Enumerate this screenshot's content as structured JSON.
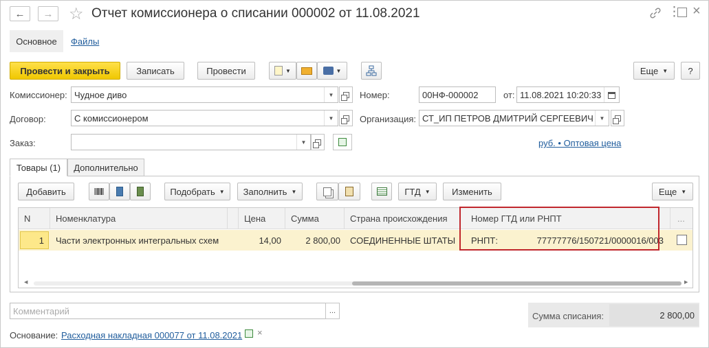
{
  "window": {
    "title": "Отчет комиссионера о списании 000002 от 11.08.2021"
  },
  "nav_tabs": {
    "main": "Основное",
    "files": "Файлы"
  },
  "toolbar": {
    "post_close": "Провести и закрыть",
    "save": "Записать",
    "post": "Провести",
    "more": "Еще",
    "help": "?"
  },
  "header": {
    "agent_label": "Комиссионер:",
    "agent_value": "Чудное диво",
    "number_label": "Номер:",
    "number_value": "00НФ-000002",
    "date_label": "от:",
    "date_value": "11.08.2021 10:20:33",
    "contract_label": "Договор:",
    "contract_value": "С комиссионером",
    "org_label": "Организация:",
    "org_value": "СТ_ИП ПЕТРОВ ДМИТРИЙ СЕРГЕЕВИЧ",
    "order_label": "Заказ:",
    "order_value": "",
    "price_link": "руб. • Оптовая цена"
  },
  "tabs": {
    "goods": "Товары (1)",
    "additional": "Дополнительно"
  },
  "grid_toolbar": {
    "add": "Добавить",
    "pick": "Подобрать",
    "fill": "Заполнить",
    "gtd": "ГТД",
    "change": "Изменить",
    "more": "Еще"
  },
  "grid": {
    "columns": [
      "N",
      "Номенклатура",
      "Цена",
      "Сумма",
      "Страна происхождения",
      "Номер ГТД или РНПТ",
      "..."
    ],
    "rows": [
      {
        "n": "1",
        "item": "Части электронных интегральных схем",
        "price": "14,00",
        "sum": "2 800,00",
        "country": "СОЕДИНЕННЫЕ ШТАТЫ",
        "gtd_prefix": "РНПТ:",
        "gtd_number": "77777776/150721/0000016/003"
      }
    ]
  },
  "footer": {
    "comment_placeholder": "Комментарий",
    "comment_btn": "...",
    "total_label": "Сумма списания:",
    "total_value": "2 800,00",
    "basis_label": "Основание:",
    "basis_link": "Расходная накладная 000077 от 11.08.2021",
    "basis_clear": "×"
  },
  "colors": {
    "primary_button": "#f5d21e",
    "highlight_border": "#c0262c",
    "selected_row": "#fbf2cf",
    "link": "#1f5c9c"
  }
}
